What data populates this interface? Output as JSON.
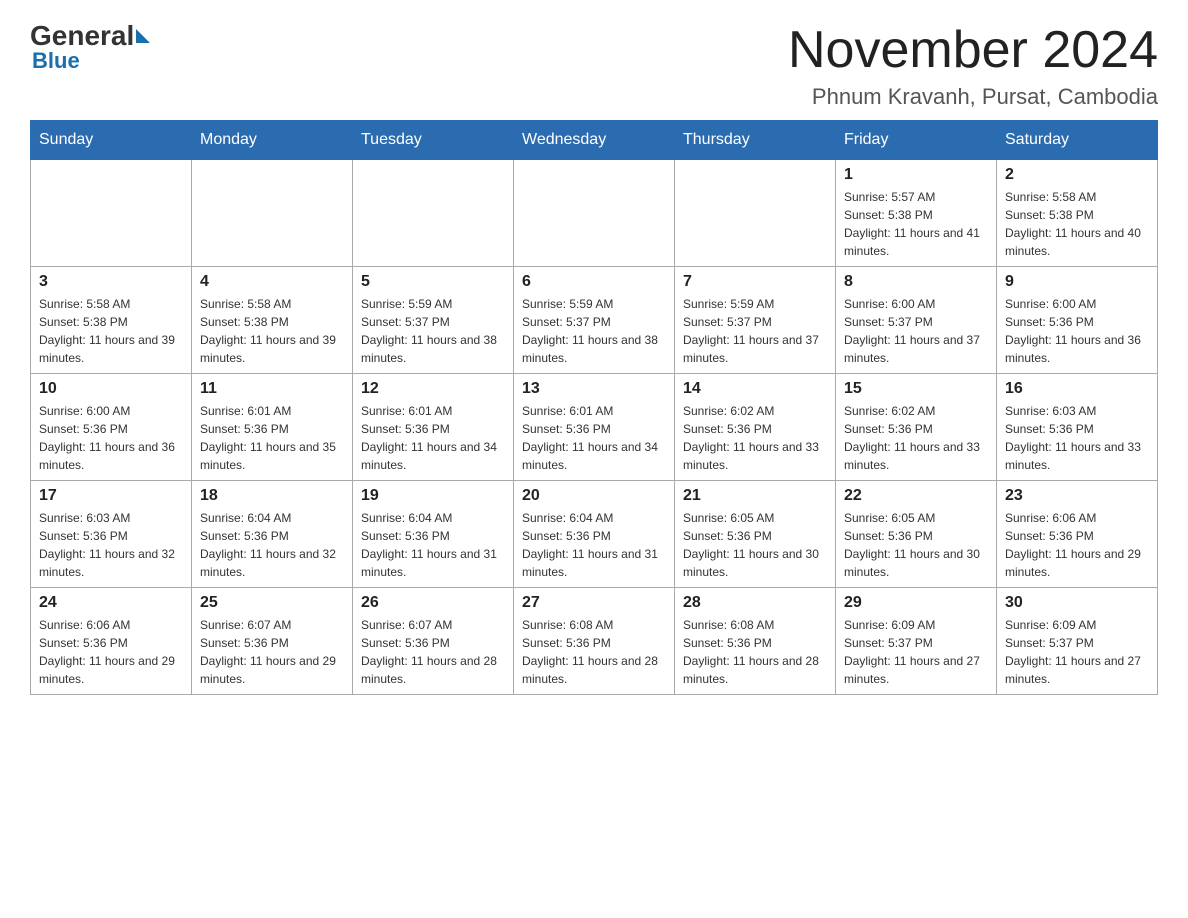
{
  "header": {
    "logo_general": "General",
    "logo_blue": "Blue",
    "month_title": "November 2024",
    "location": "Phnum Kravanh, Pursat, Cambodia"
  },
  "days_of_week": [
    "Sunday",
    "Monday",
    "Tuesday",
    "Wednesday",
    "Thursday",
    "Friday",
    "Saturday"
  ],
  "weeks": [
    [
      {
        "day": "",
        "info": ""
      },
      {
        "day": "",
        "info": ""
      },
      {
        "day": "",
        "info": ""
      },
      {
        "day": "",
        "info": ""
      },
      {
        "day": "",
        "info": ""
      },
      {
        "day": "1",
        "info": "Sunrise: 5:57 AM\nSunset: 5:38 PM\nDaylight: 11 hours and 41 minutes."
      },
      {
        "day": "2",
        "info": "Sunrise: 5:58 AM\nSunset: 5:38 PM\nDaylight: 11 hours and 40 minutes."
      }
    ],
    [
      {
        "day": "3",
        "info": "Sunrise: 5:58 AM\nSunset: 5:38 PM\nDaylight: 11 hours and 39 minutes."
      },
      {
        "day": "4",
        "info": "Sunrise: 5:58 AM\nSunset: 5:38 PM\nDaylight: 11 hours and 39 minutes."
      },
      {
        "day": "5",
        "info": "Sunrise: 5:59 AM\nSunset: 5:37 PM\nDaylight: 11 hours and 38 minutes."
      },
      {
        "day": "6",
        "info": "Sunrise: 5:59 AM\nSunset: 5:37 PM\nDaylight: 11 hours and 38 minutes."
      },
      {
        "day": "7",
        "info": "Sunrise: 5:59 AM\nSunset: 5:37 PM\nDaylight: 11 hours and 37 minutes."
      },
      {
        "day": "8",
        "info": "Sunrise: 6:00 AM\nSunset: 5:37 PM\nDaylight: 11 hours and 37 minutes."
      },
      {
        "day": "9",
        "info": "Sunrise: 6:00 AM\nSunset: 5:36 PM\nDaylight: 11 hours and 36 minutes."
      }
    ],
    [
      {
        "day": "10",
        "info": "Sunrise: 6:00 AM\nSunset: 5:36 PM\nDaylight: 11 hours and 36 minutes."
      },
      {
        "day": "11",
        "info": "Sunrise: 6:01 AM\nSunset: 5:36 PM\nDaylight: 11 hours and 35 minutes."
      },
      {
        "day": "12",
        "info": "Sunrise: 6:01 AM\nSunset: 5:36 PM\nDaylight: 11 hours and 34 minutes."
      },
      {
        "day": "13",
        "info": "Sunrise: 6:01 AM\nSunset: 5:36 PM\nDaylight: 11 hours and 34 minutes."
      },
      {
        "day": "14",
        "info": "Sunrise: 6:02 AM\nSunset: 5:36 PM\nDaylight: 11 hours and 33 minutes."
      },
      {
        "day": "15",
        "info": "Sunrise: 6:02 AM\nSunset: 5:36 PM\nDaylight: 11 hours and 33 minutes."
      },
      {
        "day": "16",
        "info": "Sunrise: 6:03 AM\nSunset: 5:36 PM\nDaylight: 11 hours and 33 minutes."
      }
    ],
    [
      {
        "day": "17",
        "info": "Sunrise: 6:03 AM\nSunset: 5:36 PM\nDaylight: 11 hours and 32 minutes."
      },
      {
        "day": "18",
        "info": "Sunrise: 6:04 AM\nSunset: 5:36 PM\nDaylight: 11 hours and 32 minutes."
      },
      {
        "day": "19",
        "info": "Sunrise: 6:04 AM\nSunset: 5:36 PM\nDaylight: 11 hours and 31 minutes."
      },
      {
        "day": "20",
        "info": "Sunrise: 6:04 AM\nSunset: 5:36 PM\nDaylight: 11 hours and 31 minutes."
      },
      {
        "day": "21",
        "info": "Sunrise: 6:05 AM\nSunset: 5:36 PM\nDaylight: 11 hours and 30 minutes."
      },
      {
        "day": "22",
        "info": "Sunrise: 6:05 AM\nSunset: 5:36 PM\nDaylight: 11 hours and 30 minutes."
      },
      {
        "day": "23",
        "info": "Sunrise: 6:06 AM\nSunset: 5:36 PM\nDaylight: 11 hours and 29 minutes."
      }
    ],
    [
      {
        "day": "24",
        "info": "Sunrise: 6:06 AM\nSunset: 5:36 PM\nDaylight: 11 hours and 29 minutes."
      },
      {
        "day": "25",
        "info": "Sunrise: 6:07 AM\nSunset: 5:36 PM\nDaylight: 11 hours and 29 minutes."
      },
      {
        "day": "26",
        "info": "Sunrise: 6:07 AM\nSunset: 5:36 PM\nDaylight: 11 hours and 28 minutes."
      },
      {
        "day": "27",
        "info": "Sunrise: 6:08 AM\nSunset: 5:36 PM\nDaylight: 11 hours and 28 minutes."
      },
      {
        "day": "28",
        "info": "Sunrise: 6:08 AM\nSunset: 5:36 PM\nDaylight: 11 hours and 28 minutes."
      },
      {
        "day": "29",
        "info": "Sunrise: 6:09 AM\nSunset: 5:37 PM\nDaylight: 11 hours and 27 minutes."
      },
      {
        "day": "30",
        "info": "Sunrise: 6:09 AM\nSunset: 5:37 PM\nDaylight: 11 hours and 27 minutes."
      }
    ]
  ]
}
